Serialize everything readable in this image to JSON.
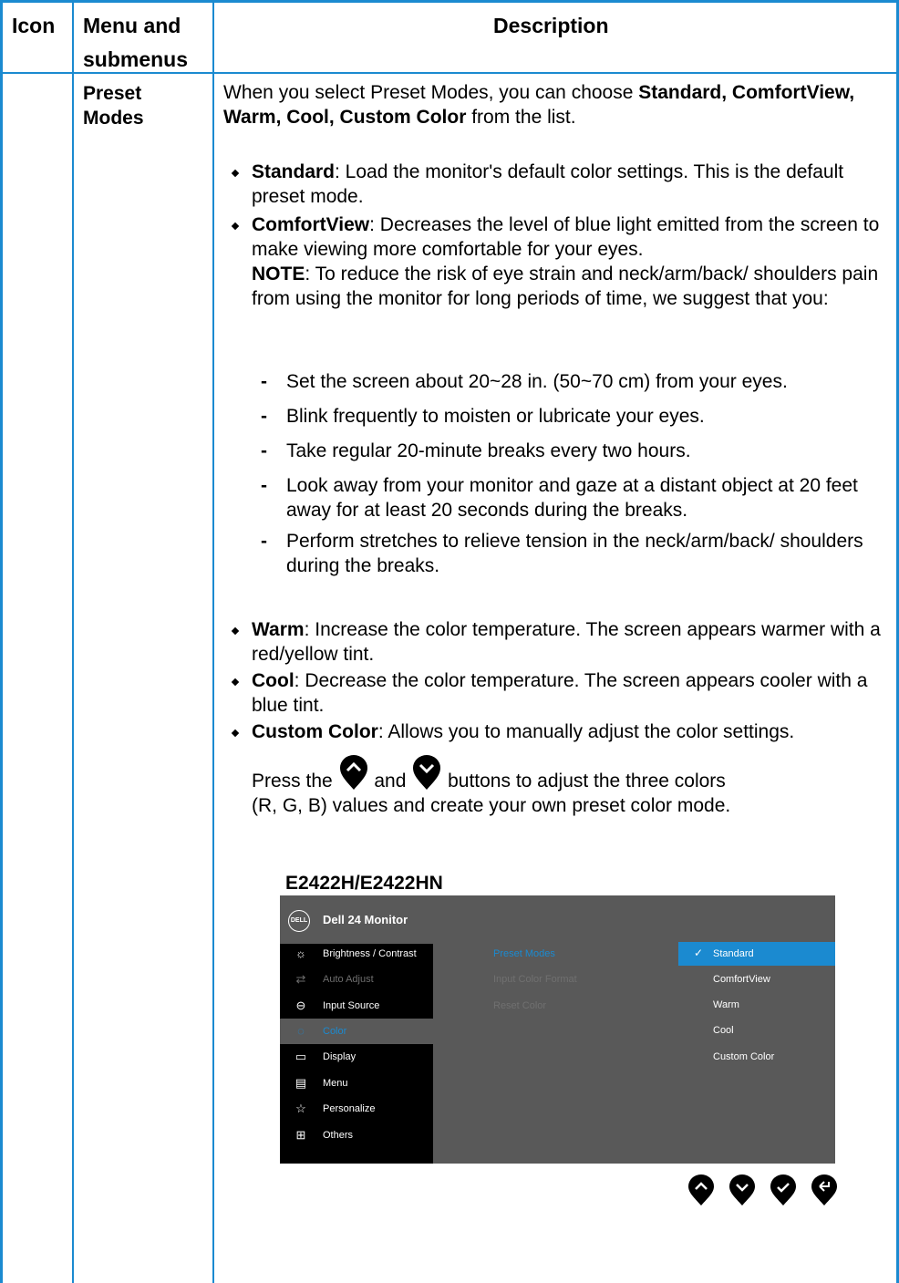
{
  "header": {
    "icon": "Icon",
    "menu_line1": "Menu and",
    "menu_line2": "submenus",
    "description": "Description"
  },
  "row": {
    "menu_line1": "Preset",
    "menu_line2": "Modes",
    "intro_a": "When you select Preset Modes, you can choose ",
    "intro_bold": "Standard, ComfortView, Warm, Cool, Custom Color",
    "intro_b": " from the list.",
    "bullets": [
      {
        "term": "Standard",
        "text": ": Load the monitor's default color settings. This is the default preset mode."
      },
      {
        "term": "ComfortView",
        "text": ": Decreases the level of blue light emitted from the screen to make viewing more comfortable for your eyes."
      }
    ],
    "note_term": "NOTE",
    "note_text": ": To reduce the risk of eye strain and neck/arm/back/ shoulders pain from using the monitor for long periods of time, we suggest that you:",
    "dashes": [
      "Set the screen about 20~28 in. (50~70 cm) from your eyes.",
      "Blink frequently to moisten or lubricate your eyes.",
      "Take regular 20-minute breaks every two hours.",
      "Look away from your monitor and gaze at a distant object at 20 feet away for at least 20 seconds during the breaks.",
      "Perform stretches to relieve tension in the neck/arm/back/ shoulders during the breaks."
    ],
    "bullets2": [
      {
        "term": "Warm",
        "text": ": Increase the color temperature. The screen appears warmer with a red/yellow tint."
      },
      {
        "term": "Cool",
        "text": ": Decrease the color temperature. The screen appears cooler with a blue tint."
      },
      {
        "term": "Custom Color",
        "text": ": Allows you to manually adjust the color settings."
      }
    ],
    "press_a": "Press the ",
    "press_and": " and ",
    "press_b": " buttons to adjust the three colors",
    "press_c": "(R, G, B) values and create your own preset color mode.",
    "model": "E2422H/E2422HN"
  },
  "osd": {
    "logo": "DELL",
    "title": "Dell 24 Monitor",
    "menu": [
      {
        "label": "Brightness / Contrast",
        "icon": "brightness-icon"
      },
      {
        "label": "Auto Adjust",
        "icon": "auto-adjust-icon"
      },
      {
        "label": "Input Source",
        "icon": "input-source-icon"
      },
      {
        "label": "Color",
        "icon": "color-icon"
      },
      {
        "label": "Display",
        "icon": "display-icon"
      },
      {
        "label": "Menu",
        "icon": "menu-icon"
      },
      {
        "label": "Personalize",
        "icon": "star-icon"
      },
      {
        "label": "Others",
        "icon": "others-icon"
      }
    ],
    "submenu": [
      "Preset Modes",
      "Input Color Format",
      "Reset Color"
    ],
    "options": [
      "Standard",
      "ComfortView",
      "Warm",
      "Cool",
      "Custom Color"
    ],
    "accent": "#1b8ad0"
  }
}
